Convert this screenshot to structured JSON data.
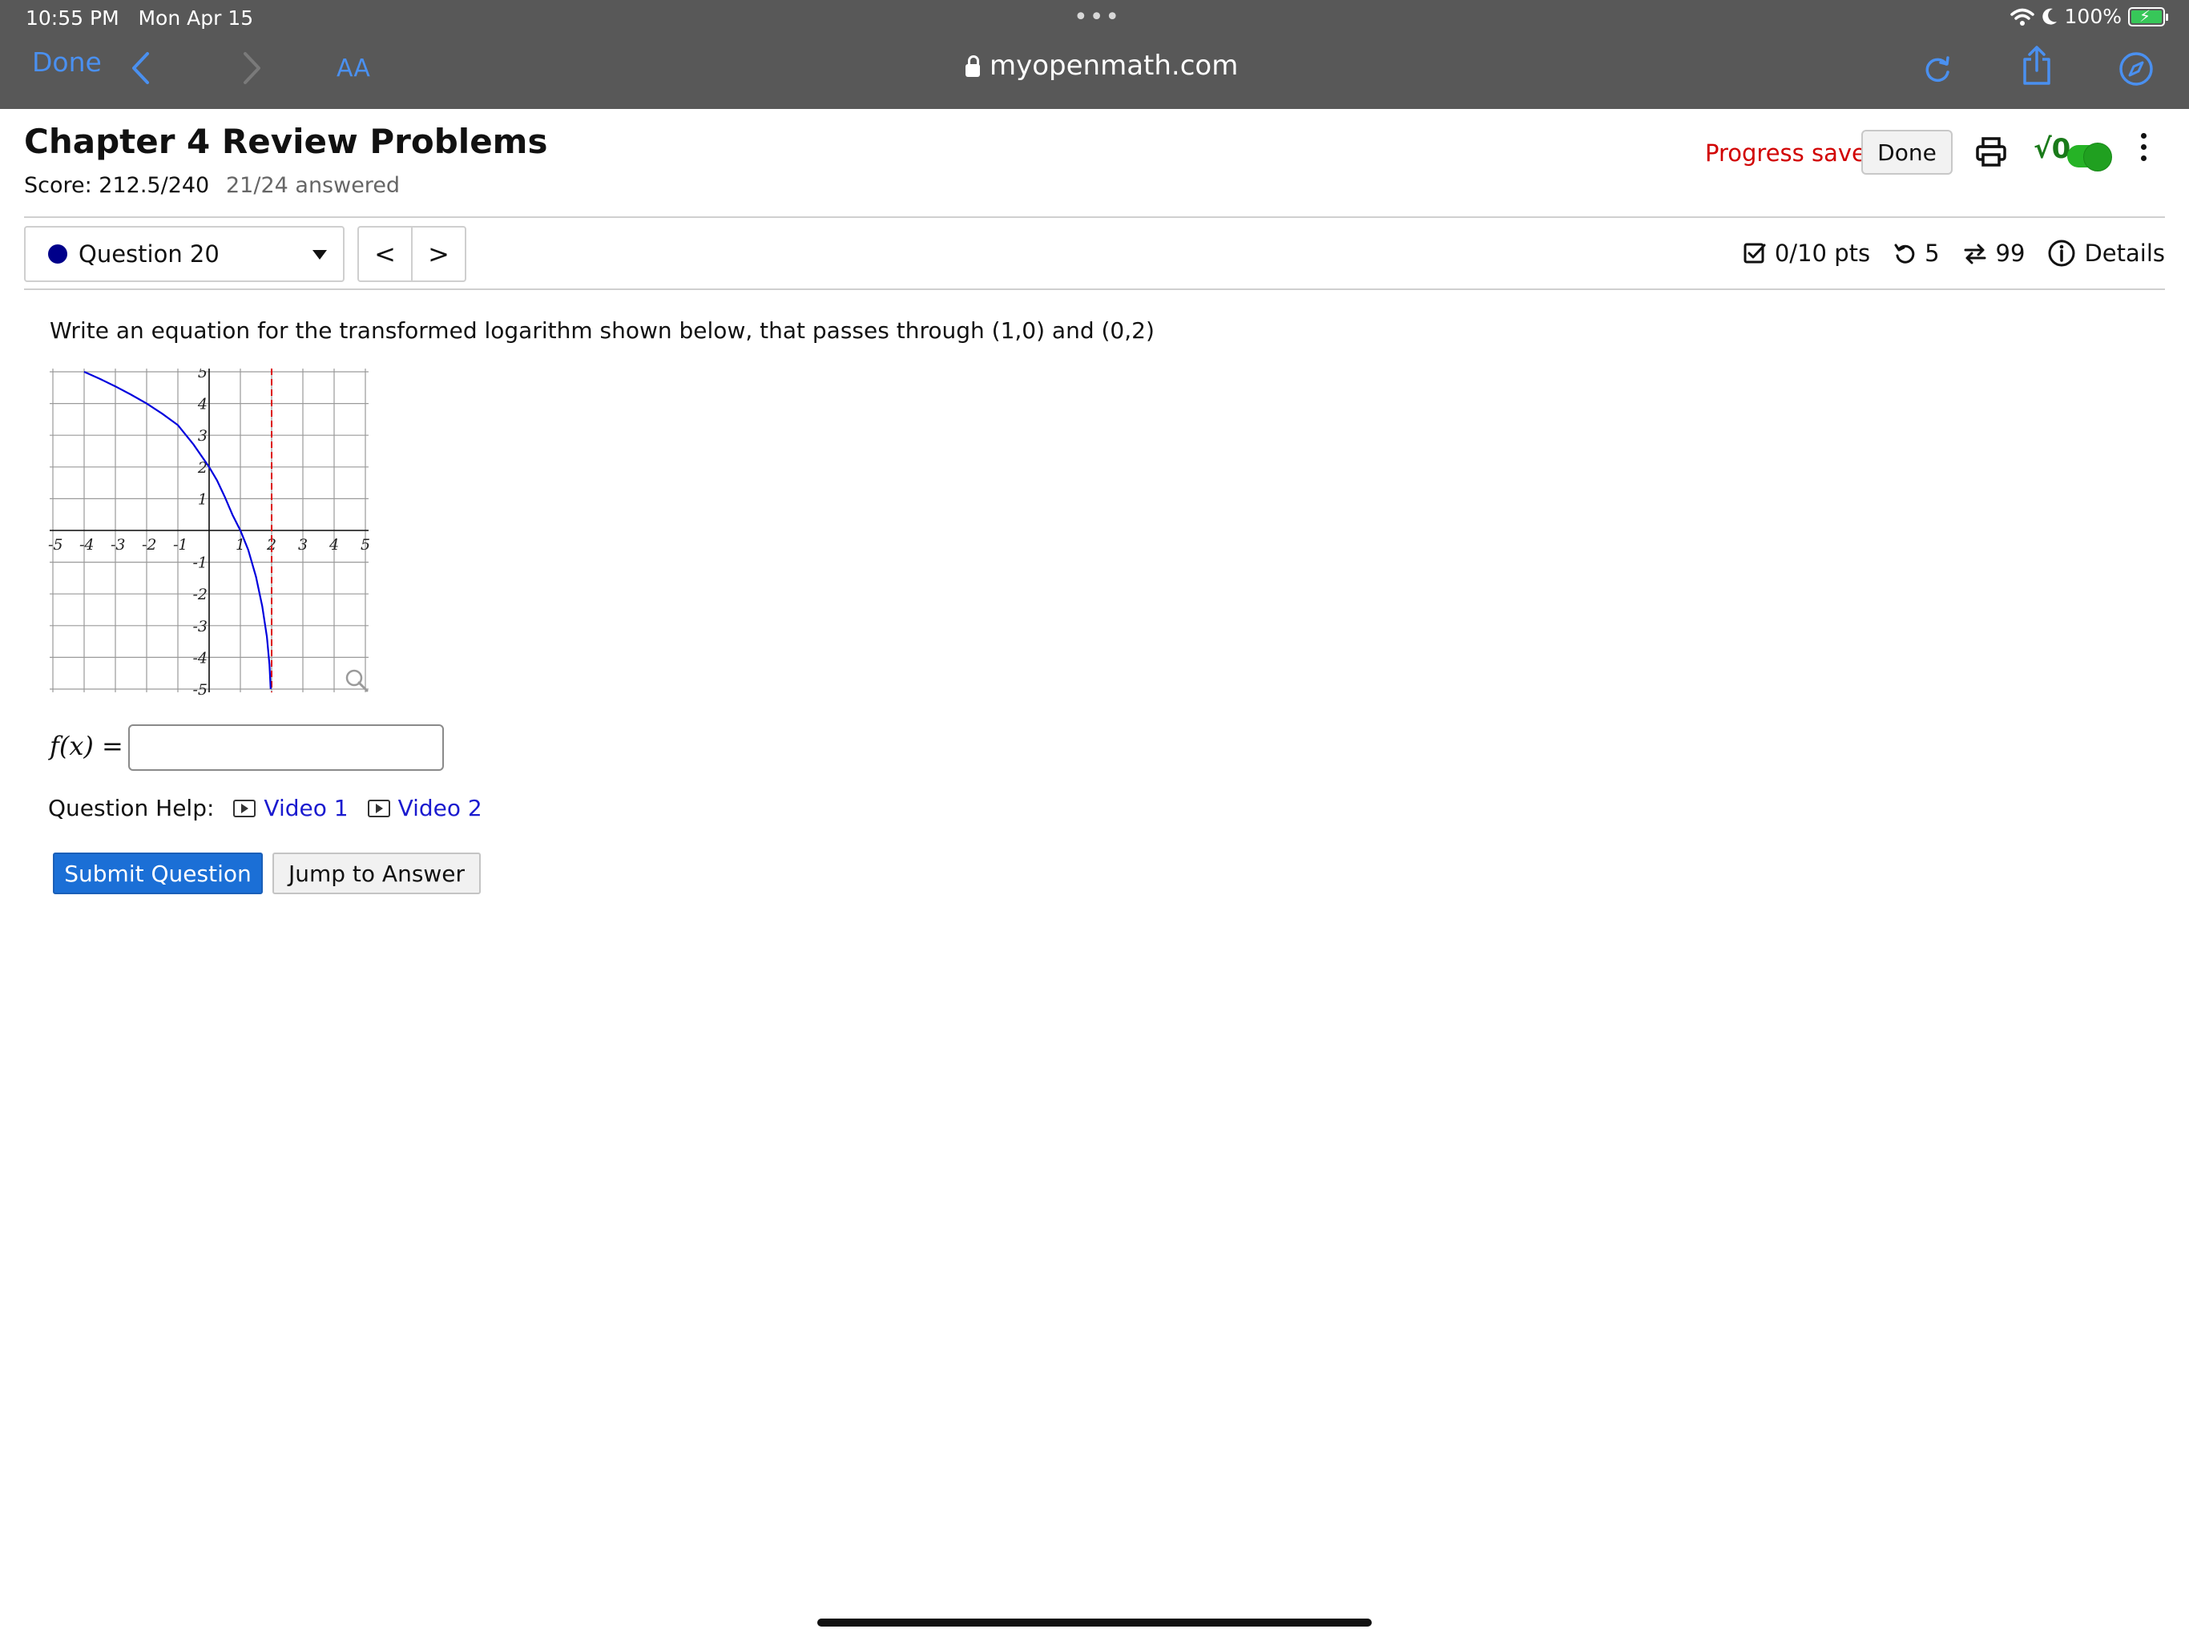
{
  "status_bar": {
    "time": "10:55 PM",
    "date": "Mon Apr 15",
    "battery": "100%"
  },
  "browser": {
    "done_label": "Done",
    "text_size_label": "AA",
    "url": "myopenmath.com"
  },
  "header": {
    "title": "Chapter 4 Review Problems",
    "score": "Score: 212.5/240",
    "answered": "21/24 answered",
    "progress_saved": "Progress saved",
    "done_label": "Done",
    "sqrt_label": "√0"
  },
  "question_nav": {
    "selected": "Question 20",
    "prev": "<",
    "next": ">"
  },
  "meta": {
    "points": "0/10 pts",
    "retries": "5",
    "versions": "99",
    "details": "Details"
  },
  "question": {
    "text": "Write an equation for the transformed logarithm shown below, that passes through (1,0) and (0,2)",
    "answer_label": "f(x) =",
    "answer_value": "",
    "help_label": "Question Help:",
    "video1": "Video 1",
    "video2": "Video 2",
    "submit_label": "Submit Question",
    "jump_label": "Jump to Answer"
  },
  "chart_data": {
    "type": "line",
    "title": "",
    "xlabel": "",
    "ylabel": "",
    "xlim": [
      -5,
      5
    ],
    "ylim": [
      -5,
      5
    ],
    "grid": true,
    "x_ticks": [
      "-5",
      "-4",
      "-3",
      "-2",
      "-1",
      "1",
      "2",
      "3",
      "4",
      "5"
    ],
    "y_ticks": [
      "5",
      "4",
      "3",
      "2",
      "1",
      "-1",
      "-2",
      "-3",
      "-4",
      "-5"
    ],
    "series": [
      {
        "color": "#0000dd",
        "x": [
          -4,
          -3.5,
          -3,
          -2.5,
          -2,
          -1.5,
          -1,
          -0.5,
          0,
          0.25,
          0.5,
          0.75,
          1,
          1.25,
          1.5,
          1.7,
          1.85,
          1.93,
          1.97
        ],
        "y": [
          5,
          4.78,
          4.54,
          4.28,
          4,
          3.68,
          3.32,
          2.71,
          2,
          1.58,
          1.06,
          0.49,
          0,
          -0.61,
          -1.46,
          -2.39,
          -3.35,
          -4.22,
          -5
        ]
      }
    ],
    "asymptote": {
      "x": 2,
      "color": "#dd0000"
    },
    "colors": {
      "curve": "#0000dd",
      "asymptote": "#dd0000"
    }
  }
}
